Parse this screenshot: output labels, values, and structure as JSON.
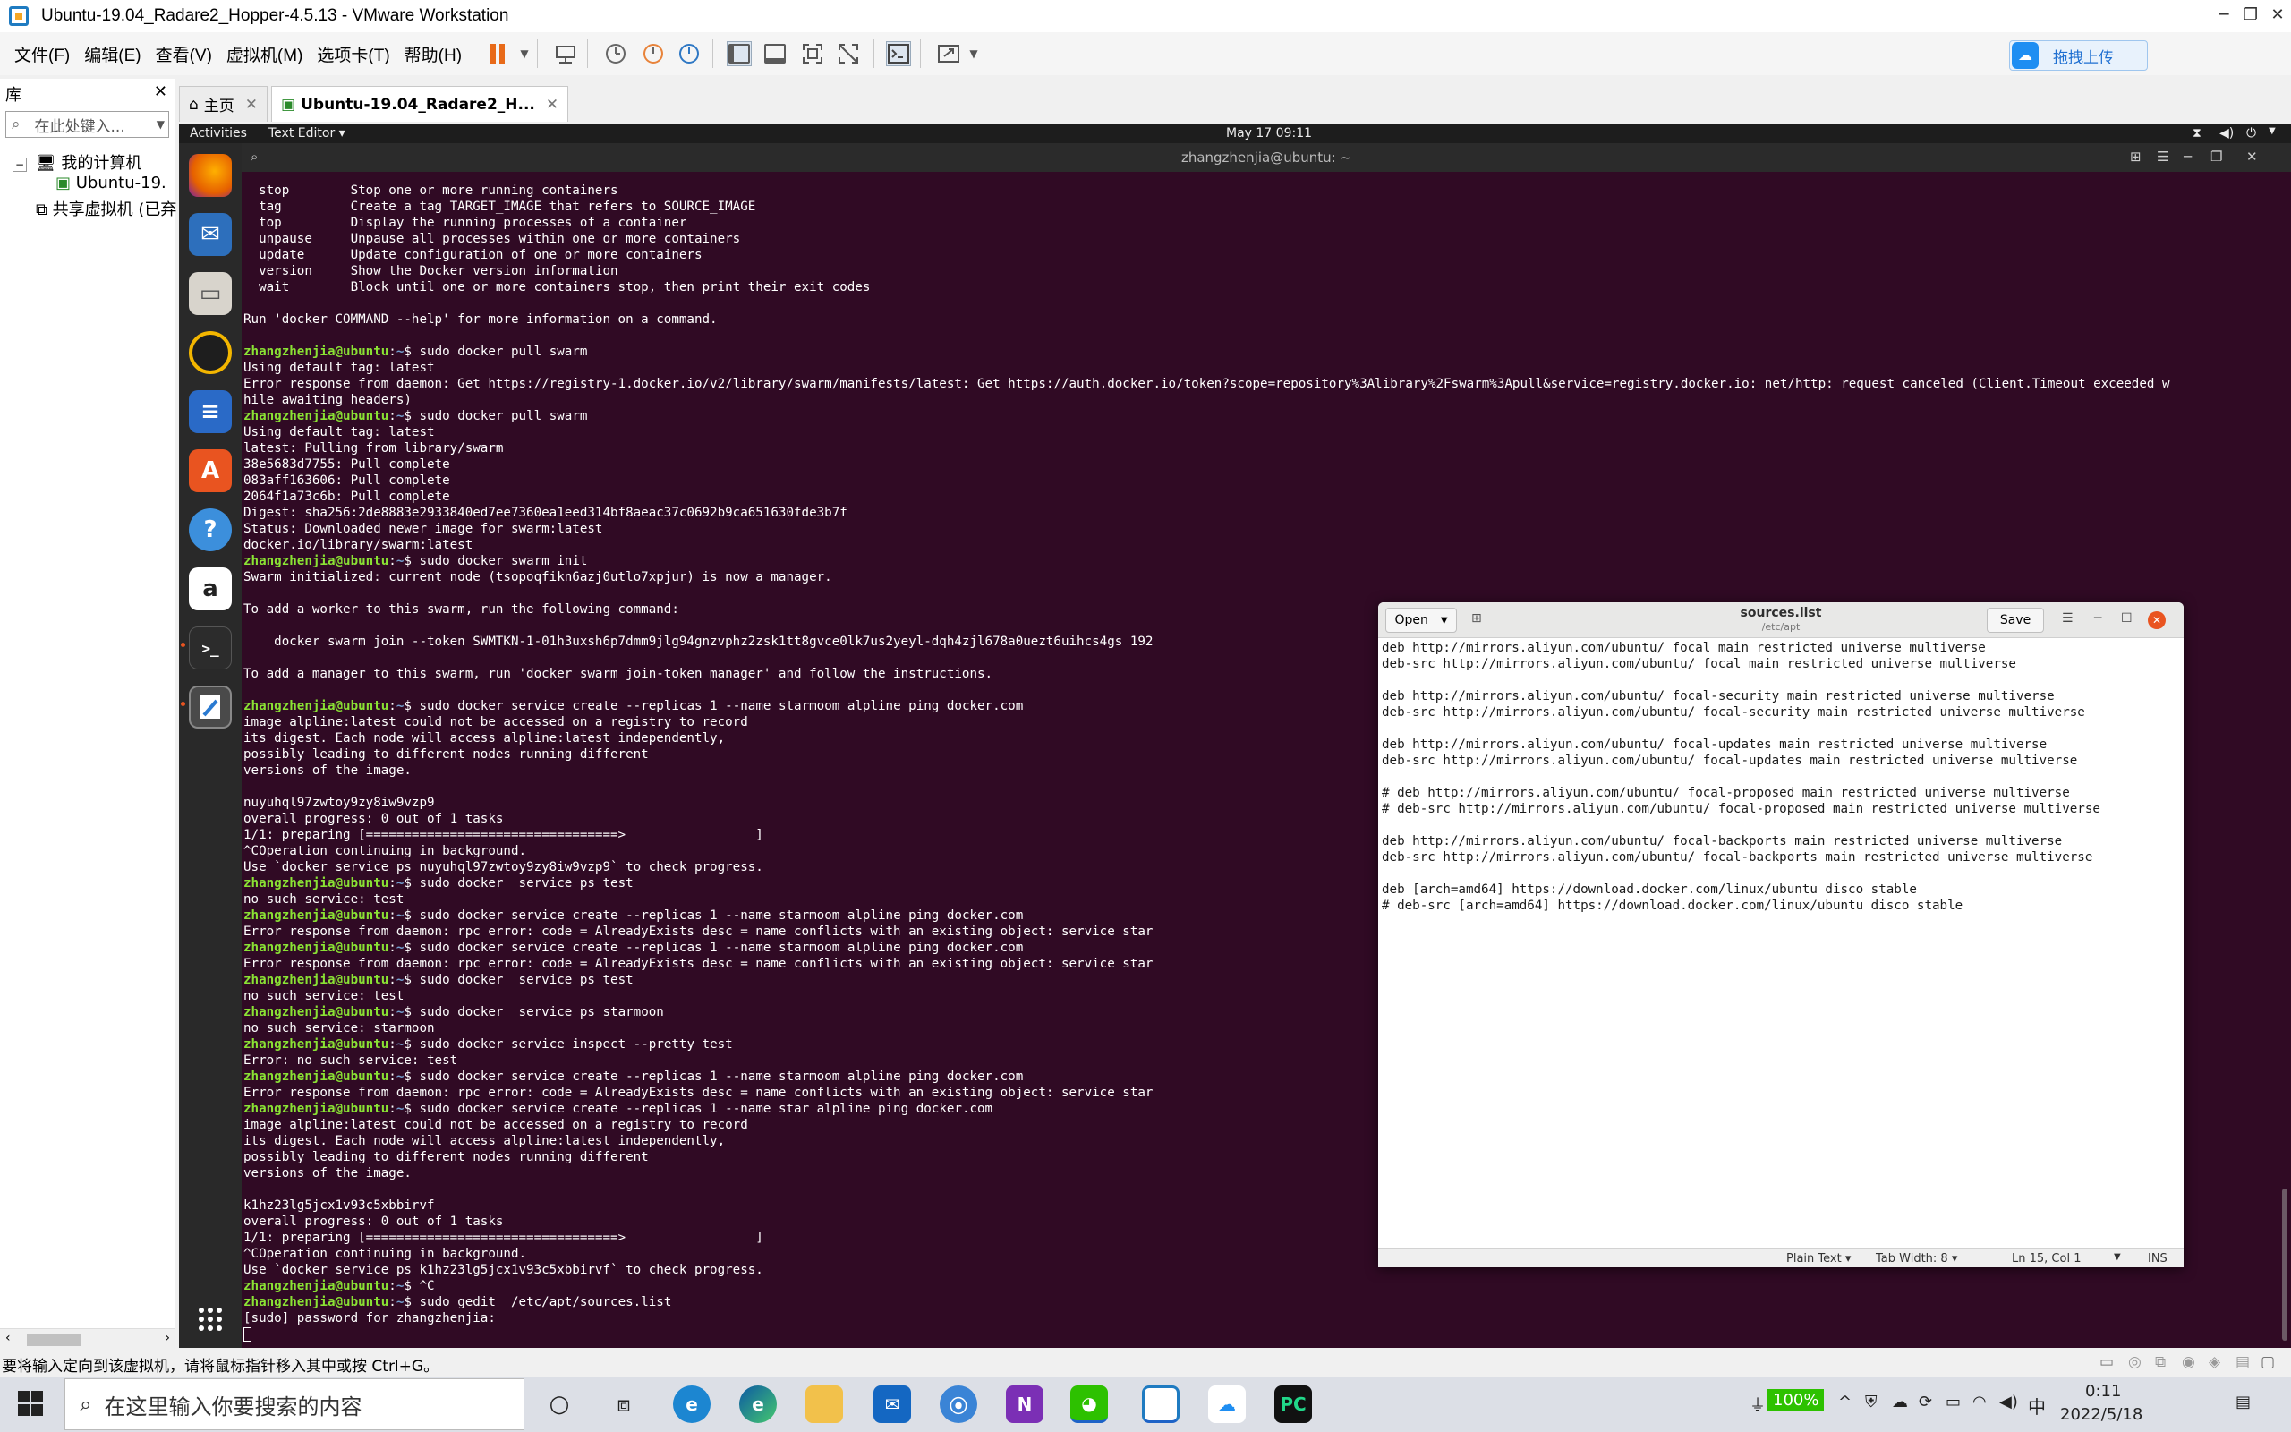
{
  "window": {
    "title": "Ubuntu-19.04_Radare2_Hopper-4.5.13 - VMware Workstation"
  },
  "menu": [
    "文件(F)",
    "编辑(E)",
    "查看(V)",
    "虚拟机(M)",
    "选项卡(T)",
    "帮助(H)"
  ],
  "upload_label": "拖拽上传",
  "library": {
    "title": "库",
    "search_placeholder": "在此处键入...",
    "tree": [
      "我的计算机",
      "Ubuntu-19.",
      "共享虚拟机 (已弃"
    ]
  },
  "tabs": [
    {
      "label": "主页"
    },
    {
      "label": "Ubuntu-19.04_Radare2_H..."
    }
  ],
  "ubuntu": {
    "activities": "Activities",
    "app_menu": "Text Editor ▾",
    "clock": "May 17  09:11",
    "terminal_title": "zhangzhenjia@ubuntu: ~"
  },
  "terminal": {
    "prompt_user": "zhangzhenjia@ubuntu",
    "prompt_sep": ":",
    "prompt_path": "~",
    "prompt_end": "$ ",
    "lines": [
      {
        "t": "  stop        Stop one or more running containers"
      },
      {
        "t": "  tag         Create a tag TARGET_IMAGE that refers to SOURCE_IMAGE"
      },
      {
        "t": "  top         Display the running processes of a container"
      },
      {
        "t": "  unpause     Unpause all processes within one or more containers"
      },
      {
        "t": "  update      Update configuration of one or more containers"
      },
      {
        "t": "  version     Show the Docker version information"
      },
      {
        "t": "  wait        Block until one or more containers stop, then print their exit codes"
      },
      {
        "t": ""
      },
      {
        "t": "Run 'docker COMMAND --help' for more information on a command."
      },
      {
        "t": ""
      },
      {
        "p": 1,
        "t": "sudo docker pull swarm"
      },
      {
        "t": "Using default tag: latest"
      },
      {
        "t": "Error response from daemon: Get https://registry-1.docker.io/v2/library/swarm/manifests/latest: Get https://auth.docker.io/token?scope=repository%3Alibrary%2Fswarm%3Apull&service=registry.docker.io: net/http: request canceled (Client.Timeout exceeded w"
      },
      {
        "t": "hile awaiting headers)"
      },
      {
        "p": 1,
        "t": "sudo docker pull swarm"
      },
      {
        "t": "Using default tag: latest"
      },
      {
        "t": "latest: Pulling from library/swarm"
      },
      {
        "t": "38e5683d7755: Pull complete"
      },
      {
        "t": "083aff163606: Pull complete"
      },
      {
        "t": "2064f1a73c6b: Pull complete"
      },
      {
        "t": "Digest: sha256:2de8883e2933840ed7ee7360ea1eed314bf8aeac37c0692b9ca651630fde3b7f"
      },
      {
        "t": "Status: Downloaded newer image for swarm:latest"
      },
      {
        "t": "docker.io/library/swarm:latest"
      },
      {
        "p": 1,
        "t": "sudo docker swarm init"
      },
      {
        "t": "Swarm initialized: current node (tsopoqfikn6azj0utlo7xpjur) is now a manager."
      },
      {
        "t": ""
      },
      {
        "t": "To add a worker to this swarm, run the following command:"
      },
      {
        "t": ""
      },
      {
        "t": "    docker swarm join --token SWMTKN-1-01h3uxsh6p7dmm9jlg94gnzvphz2zsk1tt8gvce0lk7us2yeyl-dqh4zjl678a0uezt6uihcs4gs 192"
      },
      {
        "t": ""
      },
      {
        "t": "To add a manager to this swarm, run 'docker swarm join-token manager' and follow the instructions."
      },
      {
        "t": ""
      },
      {
        "p": 1,
        "t": "sudo docker service create --replicas 1 --name starmoom alpline ping docker.com"
      },
      {
        "t": "image alpline:latest could not be accessed on a registry to record"
      },
      {
        "t": "its digest. Each node will access alpline:latest independently,"
      },
      {
        "t": "possibly leading to different nodes running different"
      },
      {
        "t": "versions of the image."
      },
      {
        "t": ""
      },
      {
        "t": "nuyuhql97zwtoy9zy8iw9vzp9"
      },
      {
        "t": "overall progress: 0 out of 1 tasks"
      },
      {
        "t": "1/1: preparing [=================================>                 ]"
      },
      {
        "t": "^COperation continuing in background."
      },
      {
        "t": "Use `docker service ps nuyuhql97zwtoy9zy8iw9vzp9` to check progress."
      },
      {
        "p": 1,
        "t": "sudo docker  service ps test"
      },
      {
        "t": "no such service: test"
      },
      {
        "p": 1,
        "t": "sudo docker service create --replicas 1 --name starmoom alpline ping docker.com"
      },
      {
        "t": "Error response from daemon: rpc error: code = AlreadyExists desc = name conflicts with an existing object: service star"
      },
      {
        "p": 1,
        "t": "sudo docker service create --replicas 1 --name starmoom alpline ping docker.com"
      },
      {
        "t": "Error response from daemon: rpc error: code = AlreadyExists desc = name conflicts with an existing object: service star"
      },
      {
        "p": 1,
        "t": "sudo docker  service ps test"
      },
      {
        "t": "no such service: test"
      },
      {
        "p": 1,
        "t": "sudo docker  service ps starmoon"
      },
      {
        "t": "no such service: starmoon"
      },
      {
        "p": 1,
        "t": "sudo docker service inspect --pretty test"
      },
      {
        "t": "Error: no such service: test"
      },
      {
        "p": 1,
        "t": "sudo docker service create --replicas 1 --name starmoom alpline ping docker.com"
      },
      {
        "t": "Error response from daemon: rpc error: code = AlreadyExists desc = name conflicts with an existing object: service star"
      },
      {
        "p": 1,
        "t": "sudo docker service create --replicas 1 --name star alpline ping docker.com"
      },
      {
        "t": "image alpline:latest could not be accessed on a registry to record"
      },
      {
        "t": "its digest. Each node will access alpline:latest independently,"
      },
      {
        "t": "possibly leading to different nodes running different"
      },
      {
        "t": "versions of the image."
      },
      {
        "t": ""
      },
      {
        "t": "k1hz23lg5jcx1v93c5xbbirvf"
      },
      {
        "t": "overall progress: 0 out of 1 tasks"
      },
      {
        "t": "1/1: preparing [=================================>                 ]"
      },
      {
        "t": "^COperation continuing in background."
      },
      {
        "t": "Use `docker service ps k1hz23lg5jcx1v93c5xbbirvf` to check progress."
      },
      {
        "p": 1,
        "t": "^C"
      },
      {
        "p": 1,
        "t": "sudo gedit  /etc/apt/sources.list"
      },
      {
        "t": "[sudo] password for zhangzhenjia: "
      }
    ]
  },
  "gedit": {
    "open_label": "Open",
    "title": "sources.list",
    "subtitle": "/etc/apt",
    "save_label": "Save",
    "lines": [
      "deb http://mirrors.aliyun.com/ubuntu/ focal main restricted universe multiverse",
      "deb-src http://mirrors.aliyun.com/ubuntu/ focal main restricted universe multiverse",
      "",
      "deb http://mirrors.aliyun.com/ubuntu/ focal-security main restricted universe multiverse",
      "deb-src http://mirrors.aliyun.com/ubuntu/ focal-security main restricted universe multiverse",
      "",
      "deb http://mirrors.aliyun.com/ubuntu/ focal-updates main restricted universe multiverse",
      "deb-src http://mirrors.aliyun.com/ubuntu/ focal-updates main restricted universe multiverse",
      "",
      "# deb http://mirrors.aliyun.com/ubuntu/ focal-proposed main restricted universe multiverse",
      "# deb-src http://mirrors.aliyun.com/ubuntu/ focal-proposed main restricted universe multiverse",
      "",
      "deb http://mirrors.aliyun.com/ubuntu/ focal-backports main restricted universe multiverse",
      "deb-src http://mirrors.aliyun.com/ubuntu/ focal-backports main restricted universe multiverse",
      "",
      "deb [arch=amd64] https://download.docker.com/linux/ubuntu disco stable",
      "# deb-src [arch=amd64] https://download.docker.com/linux/ubuntu disco stable"
    ],
    "status": {
      "language": "Plain Text ▾",
      "tab_width": "Tab Width: 8 ▾",
      "position": "Ln 15, Col 1",
      "mode": "INS"
    }
  },
  "vm_status": "要将输入定向到该虚拟机，请将鼠标指针移入其中或按 Ctrl+G。",
  "taskbar": {
    "search_placeholder": "在这里输入你要搜索的内容",
    "battery": "100%",
    "ime": "中",
    "time": "0:11",
    "date": "2022/5/18"
  },
  "colors": {
    "terminal_bg": "#300a24",
    "prompt_user": "#8ae234",
    "prompt_path": "#729fcf",
    "ubuntu_accent": "#e95420",
    "vmware_pause": "#e86a19"
  }
}
